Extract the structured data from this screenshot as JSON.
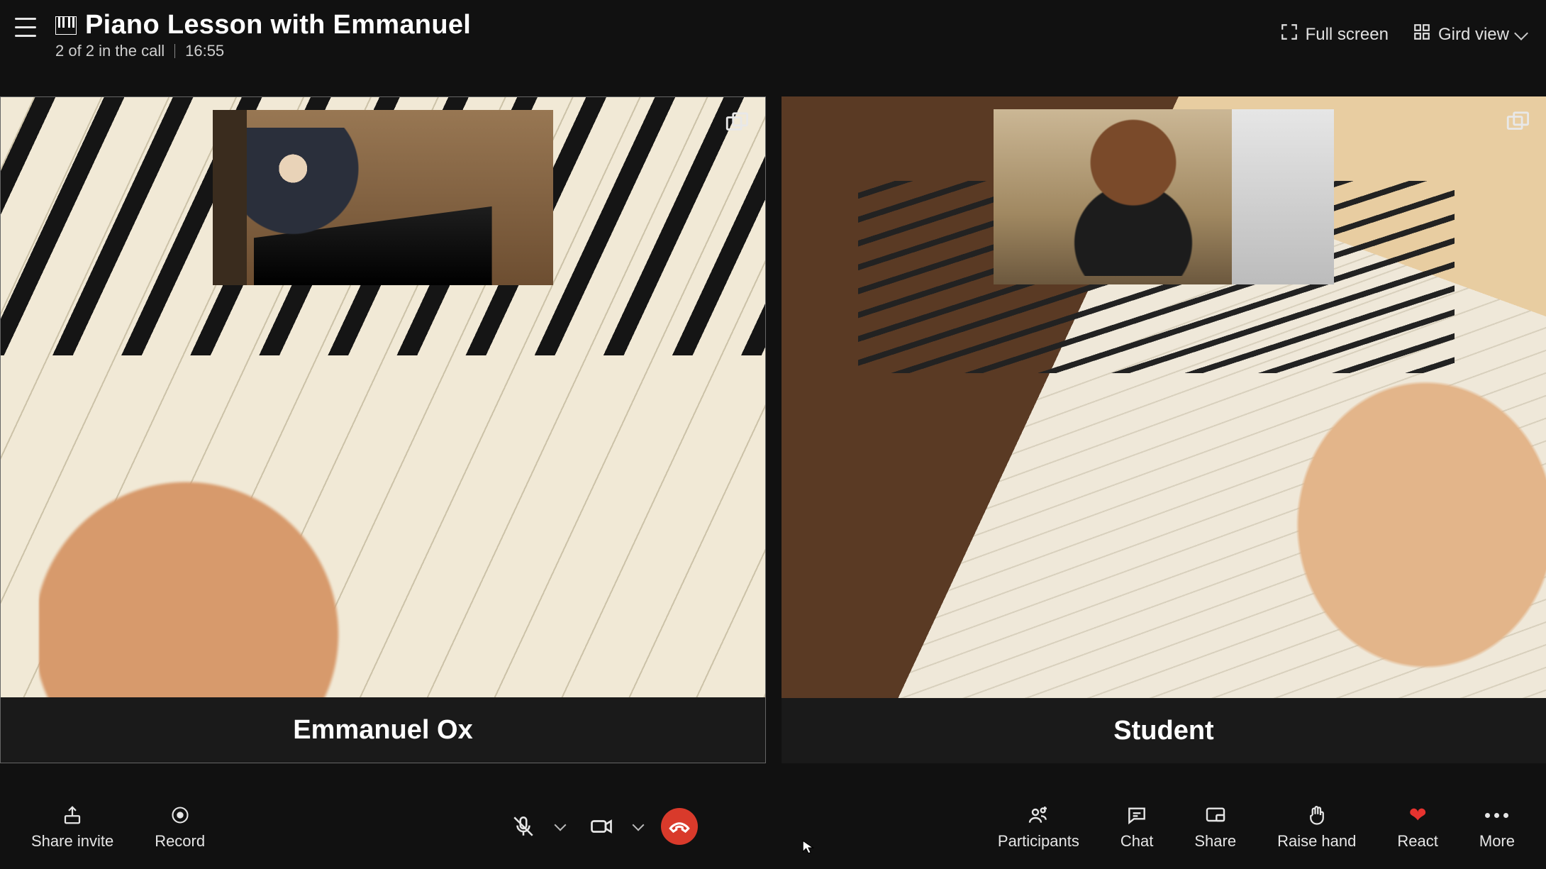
{
  "header": {
    "title": "Piano Lesson with Emmanuel",
    "participants_status": "2 of 2 in the call",
    "duration": "16:55",
    "fullscreen_label": "Full screen",
    "grid_view_label": "Gird view"
  },
  "participants": [
    {
      "name": "Emmanuel Ox",
      "active_speaker": true
    },
    {
      "name": "Student",
      "active_speaker": false
    }
  ],
  "toolbar": {
    "left": {
      "share_invite": "Share invite",
      "record": "Record"
    },
    "center": {
      "mic_muted": true,
      "camera_on": true
    },
    "right": {
      "participants": "Participants",
      "chat": "Chat",
      "share": "Share",
      "raise_hand": "Raise hand",
      "react": "React",
      "more": "More"
    }
  },
  "colors": {
    "hangup": "#d93a2b",
    "react_heart": "#e7332f"
  }
}
